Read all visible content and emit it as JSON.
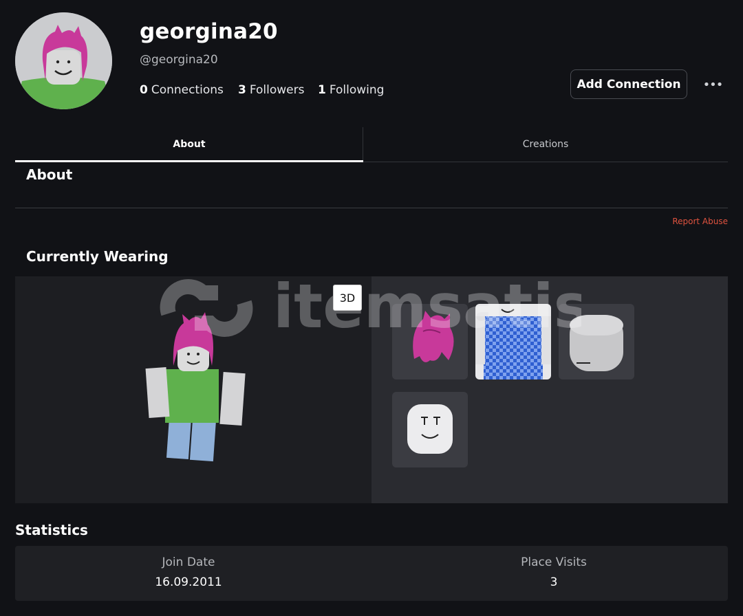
{
  "profile": {
    "display_name": "georgina20",
    "username": "@georgina20",
    "stats": [
      {
        "count": "0",
        "label": "Connections"
      },
      {
        "count": "3",
        "label": "Followers"
      },
      {
        "count": "1",
        "label": "Following"
      }
    ],
    "add_connection_label": "Add Connection",
    "more_label": "•••"
  },
  "tabs": [
    {
      "label": "About",
      "active": true
    },
    {
      "label": "Creations",
      "active": false
    }
  ],
  "about": {
    "heading": "About",
    "report_label": "Report Abuse"
  },
  "wearing": {
    "heading": "Currently Wearing",
    "toggle_3d_label": "3D",
    "items": [
      "hair-item-icon",
      "shirt-item-icon",
      "head-item-icon",
      "face-item-icon"
    ],
    "watermark_text": "itemsatis"
  },
  "statistics": {
    "heading": "Statistics",
    "join_date_label": "Join Date",
    "join_date_value": "16.09.2011",
    "place_visits_label": "Place Visits",
    "place_visits_value": "3"
  },
  "colors": {
    "background": "#111216",
    "accent_report": "#e0533f",
    "hair": "#c8399a",
    "shirt": "#5fb14d",
    "pants": "#8fb0d8"
  }
}
